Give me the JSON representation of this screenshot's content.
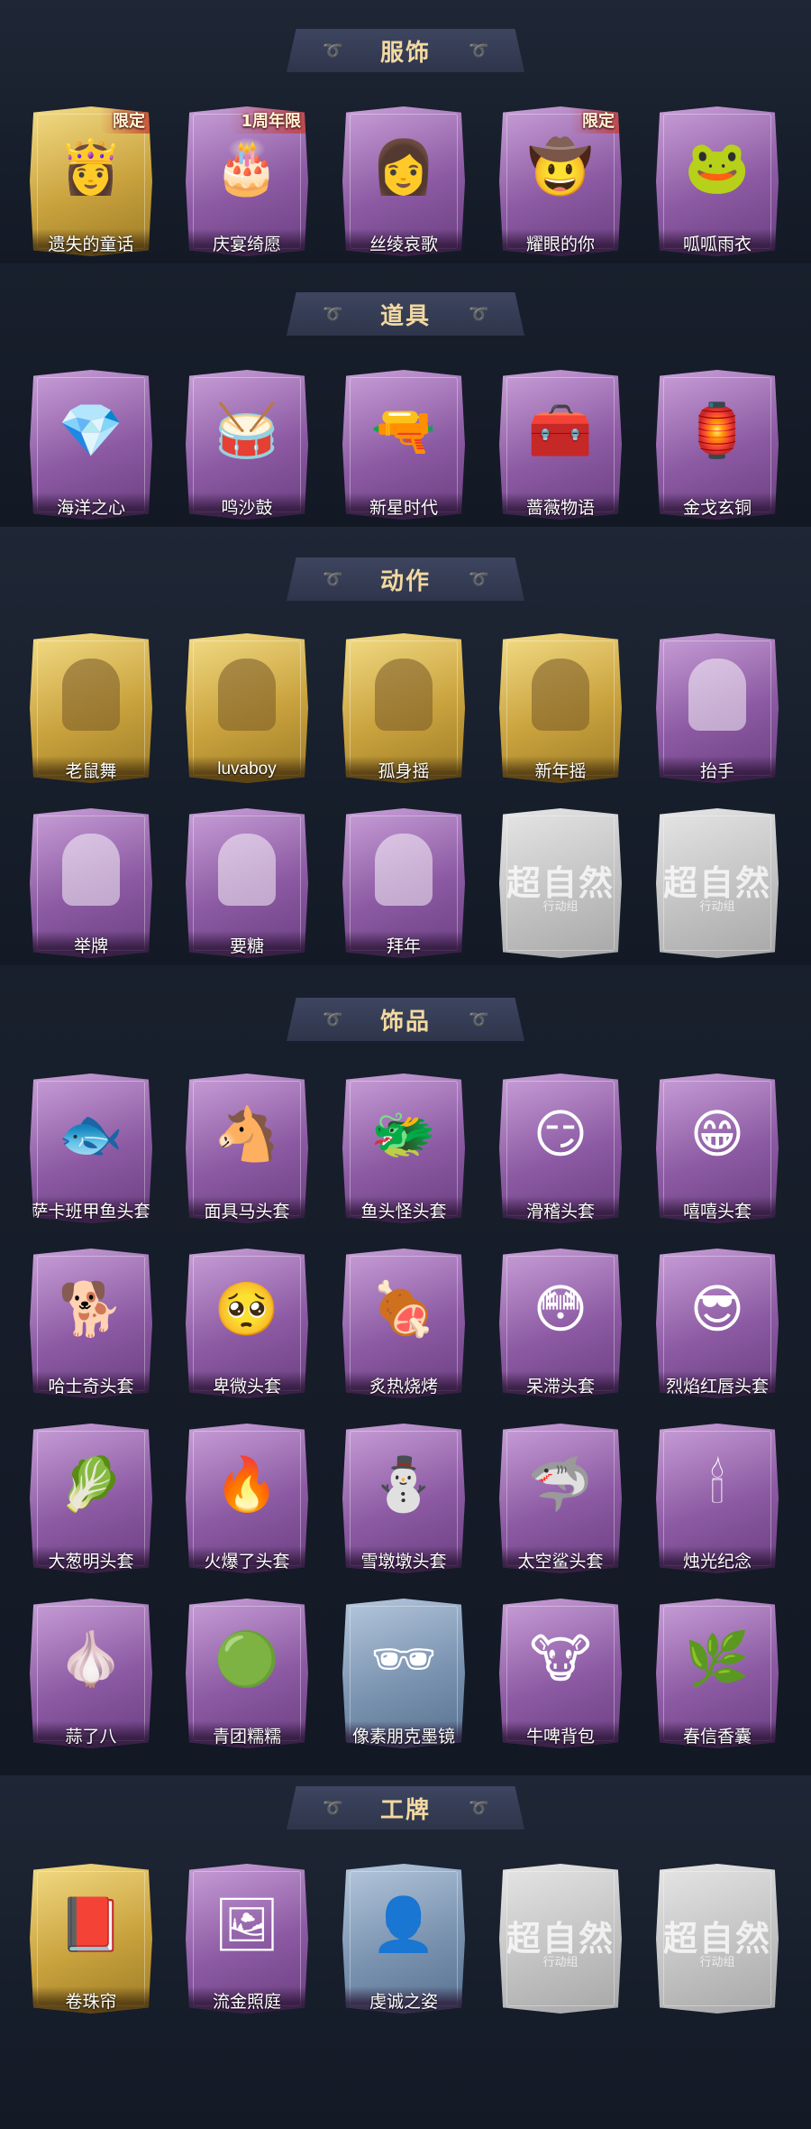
{
  "sections": {
    "costumes": {
      "title": "服饰",
      "items": [
        {
          "label": "遗失的童话",
          "badge": "限定",
          "icon": "princess-costume-icon"
        },
        {
          "label": "庆宴绮愿",
          "badge": "1周年限",
          "icon": "birthday-cake-costume-icon"
        },
        {
          "label": "丝绫哀歌",
          "icon": "gothic-dress-costume-icon"
        },
        {
          "label": "耀眼的你",
          "badge": "限定",
          "icon": "cowgirl-costume-icon"
        },
        {
          "label": "呱呱雨衣",
          "icon": "frog-raincoat-costume-icon"
        }
      ]
    },
    "props": {
      "title": "道具",
      "items": [
        {
          "label": "海洋之心",
          "icon": "necklace-icon"
        },
        {
          "label": "鸣沙鼓",
          "icon": "drum-icon"
        },
        {
          "label": "新星时代",
          "icon": "revolver-icon"
        },
        {
          "label": "蔷薇物语",
          "icon": "medkit-icon"
        },
        {
          "label": "金戈玄铜",
          "icon": "bronze-lantern-icon"
        }
      ]
    },
    "actions": {
      "title": "动作",
      "items": [
        {
          "label": "老鼠舞",
          "icon": "dance-pose-icon"
        },
        {
          "label": "luvaboy",
          "icon": "dance-pose-icon"
        },
        {
          "label": "孤身摇",
          "icon": "dance-pose-icon"
        },
        {
          "label": "新年摇",
          "icon": "dance-pose-icon"
        },
        {
          "label": "抬手",
          "icon": "raise-hand-pose-icon"
        },
        {
          "label": "举牌",
          "icon": "hold-sign-pose-icon"
        },
        {
          "label": "要糖",
          "icon": "ask-candy-pose-icon"
        },
        {
          "label": "拜年",
          "icon": "greeting-pose-icon"
        },
        {
          "label": "",
          "icon": "locked-placeholder-icon",
          "watermark": "超自然",
          "watermark_sub": "行动组"
        },
        {
          "label": "",
          "icon": "locked-placeholder-icon",
          "watermark": "超自然",
          "watermark_sub": "行动组"
        }
      ]
    },
    "accessories": {
      "title": "饰品",
      "items": [
        {
          "label": "萨卡班甲鱼头套",
          "icon": "fish-head-icon"
        },
        {
          "label": "面具马头套",
          "icon": "horse-head-icon"
        },
        {
          "label": "鱼头怪头套",
          "icon": "fishman-head-icon"
        },
        {
          "label": "滑稽头套",
          "icon": "funny-face-icon"
        },
        {
          "label": "嘻嘻头套",
          "icon": "grin-face-icon"
        },
        {
          "label": "哈士奇头套",
          "icon": "husky-head-icon"
        },
        {
          "label": "卑微头套",
          "icon": "humble-face-icon"
        },
        {
          "label": "炙热烧烤",
          "icon": "bbq-head-icon"
        },
        {
          "label": "呆滞头套",
          "icon": "blank-face-icon"
        },
        {
          "label": "烈焰红唇头套",
          "icon": "pikachu-head-icon"
        },
        {
          "label": "大葱明头套",
          "icon": "scallion-head-icon"
        },
        {
          "label": "火爆了头套",
          "icon": "fire-head-icon"
        },
        {
          "label": "雪墩墩头套",
          "icon": "snowman-head-icon"
        },
        {
          "label": "太空鲨头套",
          "icon": "shark-head-icon"
        },
        {
          "label": "烛光纪念",
          "icon": "candle-icon"
        },
        {
          "label": "蒜了八",
          "icon": "garlic-head-icon"
        },
        {
          "label": "青团糯糯",
          "icon": "green-dumpling-icon"
        },
        {
          "label": "像素朋克墨镜",
          "icon": "pixel-sunglasses-icon"
        },
        {
          "label": "牛啤背包",
          "icon": "cow-backpack-icon"
        },
        {
          "label": "春信香囊",
          "icon": "sachet-icon"
        }
      ]
    },
    "badges": {
      "title": "工牌",
      "items": [
        {
          "label": "卷珠帘",
          "icon": "pearl-curtain-badge-icon"
        },
        {
          "label": "流金照庭",
          "icon": "golden-frame-badge-icon"
        },
        {
          "label": "虔诚之姿",
          "icon": "silhouette-badge-icon"
        },
        {
          "label": "",
          "icon": "locked-placeholder-icon",
          "watermark": "超自然",
          "watermark_sub": "行动组"
        },
        {
          "label": "",
          "icon": "locked-placeholder-icon",
          "watermark": "超自然",
          "watermark_sub": "行动组"
        }
      ]
    }
  },
  "colors": {
    "background": "#131a26",
    "header_title": "#f3d9a0",
    "rarity_purple": "#8c5aa3",
    "rarity_gold": "#c9a23d",
    "rarity_blue": "#7a93b0",
    "locked_grey": "#c3c3c3"
  }
}
